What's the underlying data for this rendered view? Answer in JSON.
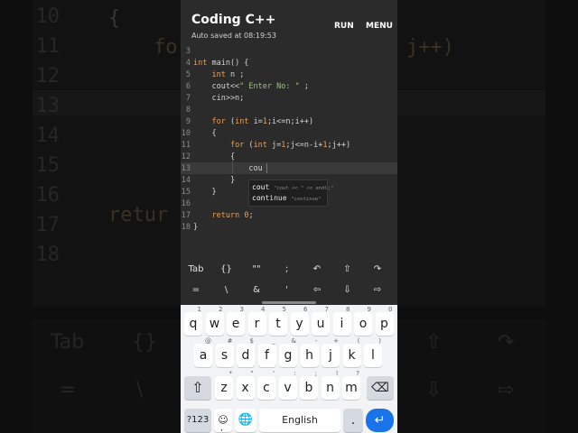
{
  "app": {
    "title": "Coding C++",
    "subtitle": "Auto saved at 08:19:53",
    "run_label": "RUN",
    "menu_label": "MENU"
  },
  "editor": {
    "lines": [
      {
        "n": "3",
        "text": ""
      },
      {
        "n": "4",
        "text": "int main() {"
      },
      {
        "n": "5",
        "text": "    int n ;"
      },
      {
        "n": "6",
        "text": "    cout<<\" Enter No: \" ;"
      },
      {
        "n": "7",
        "text": "    cin>>n;"
      },
      {
        "n": "8",
        "text": ""
      },
      {
        "n": "9",
        "text": "    for (int i=1;i<=n;i++)"
      },
      {
        "n": "10",
        "text": "    {"
      },
      {
        "n": "11",
        "text": "        for (int j=1;j<=n-i+1;j++)"
      },
      {
        "n": "12",
        "text": "        {"
      },
      {
        "n": "13",
        "text": "            cou"
      },
      {
        "n": "14",
        "text": "        }"
      },
      {
        "n": "15",
        "text": "    }"
      },
      {
        "n": "16",
        "text": ""
      },
      {
        "n": "17",
        "text": "    return 0;"
      },
      {
        "n": "18",
        "text": "}"
      }
    ],
    "current_line": "13"
  },
  "suggestions": [
    {
      "match": "cou",
      "rest": "t",
      "hint": "\"cout << \" << endl;\""
    },
    {
      "match": "con",
      "rest": "tinue",
      "hint": "\"continue\""
    }
  ],
  "symbol_bar": {
    "row1": [
      "Tab",
      "{}",
      "\"\"",
      ";",
      "↶",
      "⇧",
      "↷"
    ],
    "row2": [
      "=",
      "\\",
      "&",
      "'",
      "⇦",
      "⇩",
      "⇨"
    ]
  },
  "keyboard": {
    "row1": [
      {
        "k": "q",
        "n": "1"
      },
      {
        "k": "w",
        "n": "2"
      },
      {
        "k": "e",
        "n": "3"
      },
      {
        "k": "r",
        "n": "4"
      },
      {
        "k": "t",
        "n": "5"
      },
      {
        "k": "y",
        "n": "6"
      },
      {
        "k": "u",
        "n": "7"
      },
      {
        "k": "i",
        "n": "8"
      },
      {
        "k": "o",
        "n": "9"
      },
      {
        "k": "p",
        "n": "0"
      }
    ],
    "row2": [
      {
        "k": "a",
        "n": "@"
      },
      {
        "k": "s",
        "n": "#"
      },
      {
        "k": "d",
        "n": "$"
      },
      {
        "k": "f",
        "n": "_"
      },
      {
        "k": "g",
        "n": "&"
      },
      {
        "k": "h",
        "n": "-"
      },
      {
        "k": "j",
        "n": "+"
      },
      {
        "k": "k",
        "n": "("
      },
      {
        "k": "l",
        "n": ")"
      }
    ],
    "row3": [
      {
        "k": "z",
        "n": "*"
      },
      {
        "k": "x",
        "n": "\""
      },
      {
        "k": "c",
        "n": "'"
      },
      {
        "k": "v",
        "n": ":"
      },
      {
        "k": "b",
        "n": ";"
      },
      {
        "k": "n",
        "n": "!"
      },
      {
        "k": "m",
        "n": "?"
      }
    ],
    "symbols_label": "?123",
    "emoji_label": "☺",
    "comma_label": ",",
    "space_label": "English",
    "period_label": "."
  },
  "background": {
    "lines": [
      "10",
      "11",
      "12",
      "13",
      "14",
      "15",
      "16",
      "17",
      "18"
    ],
    "keys_row1": [
      "Tab",
      "{}",
      "⇧",
      "↷"
    ],
    "keys_row2": [
      "=",
      "\\",
      "⇩",
      "⇨"
    ],
    "code_frag1": "{",
    "code_frag2": "fo",
    "code_frag3": "j++)",
    "code_frag4": "retur"
  }
}
